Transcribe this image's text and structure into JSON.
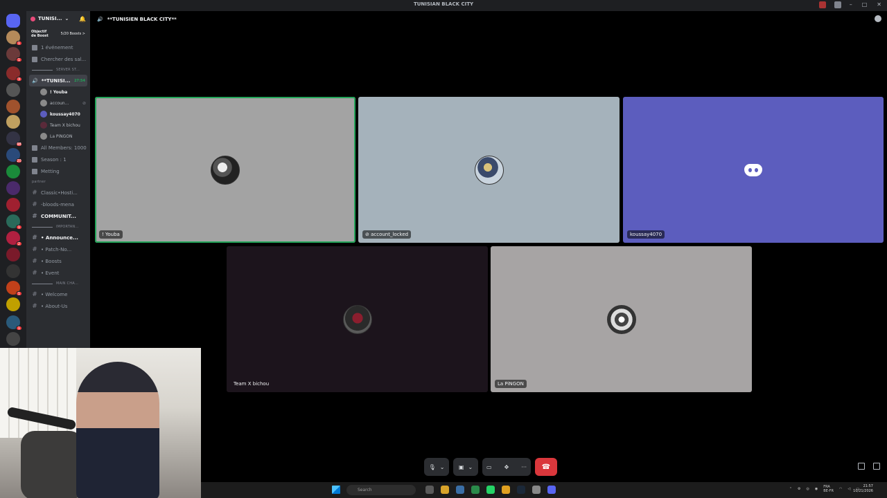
{
  "window": {
    "title": "TUNISIAN BLACK CITY"
  },
  "server": {
    "name": "TUNISI...",
    "boost_goal": "Objectif de Boost",
    "boost_count": "5/20 Boosts >"
  },
  "channels": {
    "events": "1 événement",
    "search": "Chercher des sal...",
    "server_stats_cat": "SERVER ST...",
    "voice_channel": "**TUNISI...",
    "voice_time": "27:54",
    "voice_users": [
      {
        "name": "! Youba"
      },
      {
        "name": "accoun..."
      },
      {
        "name": "koussay4070"
      },
      {
        "name": "Team X bichou"
      },
      {
        "name": "La PiNGON"
      }
    ],
    "stats": [
      "All Members: 1000",
      "Season : 1",
      "Metting"
    ],
    "partner_cat": "partner",
    "partner_channels": [
      "Classic•Hosti...",
      "-bloods-mena",
      "COMMUNIT..."
    ],
    "important_cat": "IMPORTAN...",
    "important_channels": [
      "• Announce...",
      "• Patch-No...",
      "• Boosts",
      "• Event"
    ],
    "main_cat": "MAIN CHA...",
    "main_channels": [
      "• Welcome",
      "• About-Us"
    ]
  },
  "voice_header": {
    "title": "**TUNISIEN BLACK CITY**"
  },
  "tiles": [
    {
      "name": "! Youba",
      "bg": "#a3a3a3"
    },
    {
      "name": "account_locked",
      "bg": "#a5b2bb"
    },
    {
      "name": "koussay4070",
      "bg": "#5c5dbe"
    },
    {
      "name": "Team X bichou",
      "bg": "#1c141c"
    },
    {
      "name": "La PiNGON",
      "bg": "#a7a4a4"
    }
  ],
  "taskbar": {
    "search_placeholder": "Search",
    "lang": "FRA",
    "lang_sub": "BE-FR",
    "time": "21:57",
    "date": "10/21/2026"
  },
  "colors": {
    "speaking": "#23a559",
    "hangup": "#da373c",
    "blurple": "#5865f2"
  }
}
